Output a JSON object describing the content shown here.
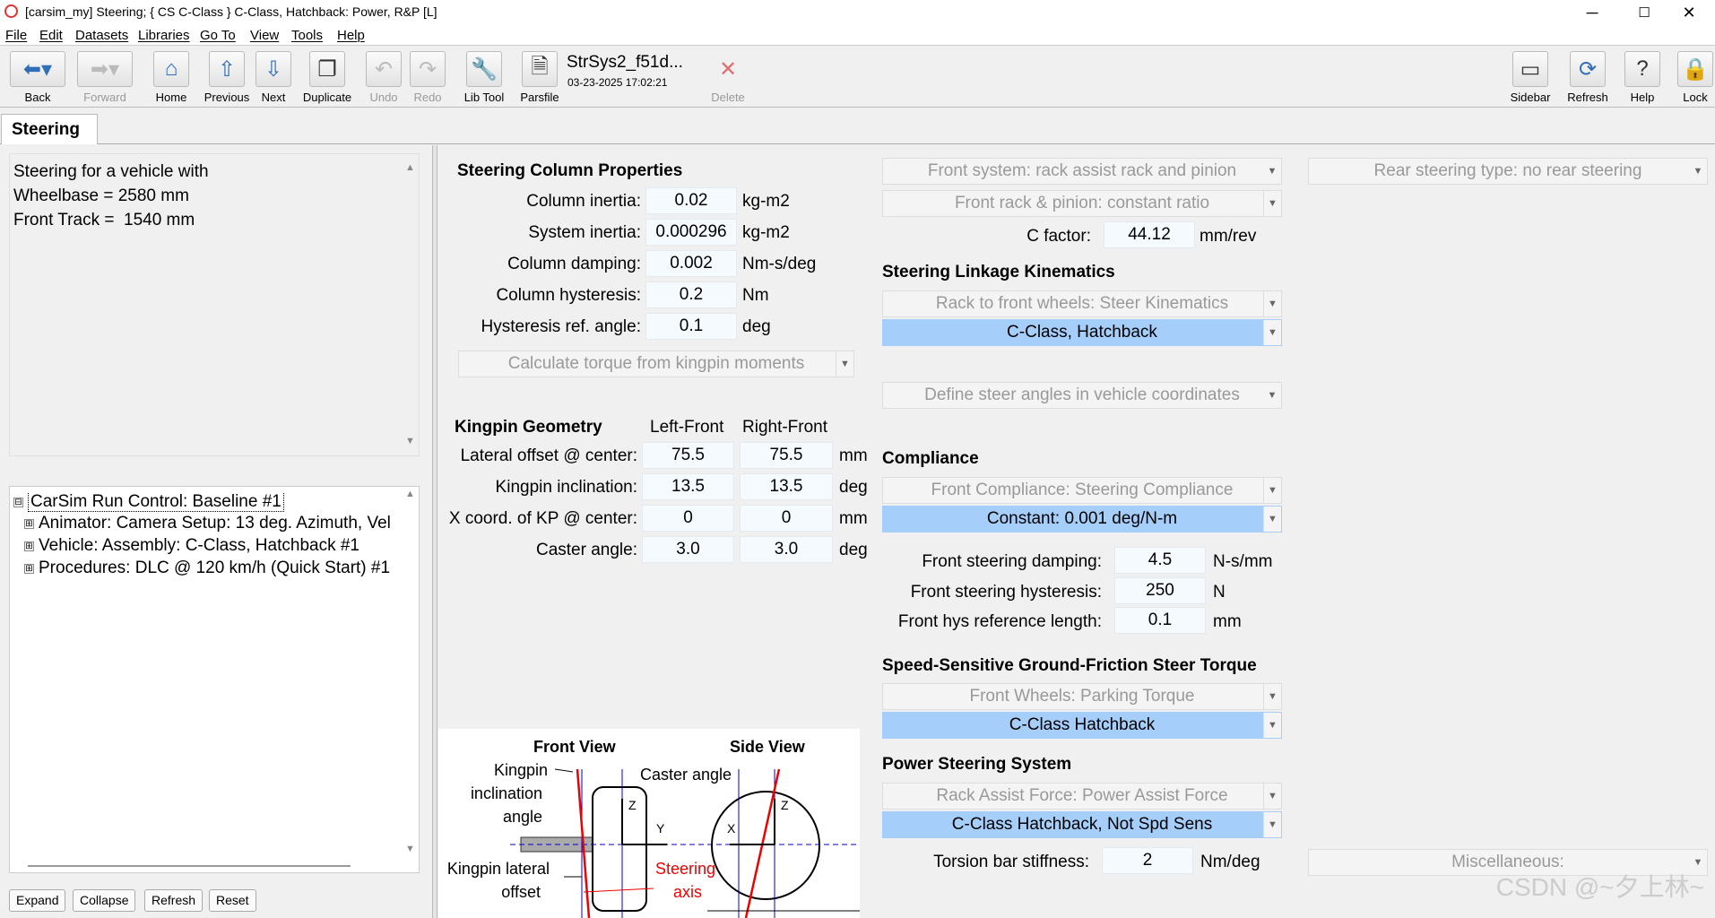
{
  "window": {
    "title": "[carsim_my] Steering; { CS C-Class } C-Class, Hatchback: Power, R&P [L]",
    "minimize": "─",
    "maximize": "☐",
    "close": "✕"
  },
  "menu": [
    "File",
    "Edit",
    "Datasets",
    "Libraries",
    "Go To",
    "View",
    "Tools",
    "Help"
  ],
  "toolbar": {
    "back": "Back",
    "forward": "Forward",
    "home": "Home",
    "previous": "Previous",
    "next": "Next",
    "duplicate": "Duplicate",
    "undo": "Undo",
    "redo": "Redo",
    "libtool": "Lib Tool",
    "parsfile": "Parsfile",
    "delete": "Delete",
    "sidebar": "Sidebar",
    "refresh": "Refresh",
    "help": "Help",
    "lock": "Lock",
    "dataset_name": "StrSys2_f51d...",
    "dataset_date": "03-23-2025 17:02:21"
  },
  "tab": "Steering",
  "notes": "Steering for a vehicle with\nWheelbase = 2580 mm\nFront Track =  1540 mm",
  "tree": {
    "root": "CarSim Run Control: Baseline #1",
    "items": [
      "Animator: Camera Setup: 13 deg. Azimuth, Vel",
      "Vehicle: Assembly: C-Class, Hatchback #1",
      "Procedures: DLC @ 120 km/h (Quick Start) #1"
    ],
    "expand": "⊞",
    "collapse": "⊟"
  },
  "buttons": {
    "expand": "Expand",
    "collapse": "Collapse",
    "refresh": "Refresh",
    "reset": "Reset"
  },
  "column": {
    "title": "Steering Column Properties",
    "rows": [
      {
        "label": "Column inertia:",
        "value": "0.02",
        "unit": "kg-m2"
      },
      {
        "label": "System inertia:",
        "value": "0.000296",
        "unit": "kg-m2"
      },
      {
        "label": "Column damping:",
        "value": "0.002",
        "unit": "Nm-s/deg"
      },
      {
        "label": "Column hysteresis:",
        "value": "0.2",
        "unit": "Nm"
      },
      {
        "label": "Hysteresis ref. angle:",
        "value": "0.1",
        "unit": "deg"
      }
    ],
    "torque_combo": "Calculate torque from kingpin moments"
  },
  "kingpin": {
    "title": "Kingpin Geometry",
    "left": "Left-Front",
    "right": "Right-Front",
    "rows": [
      {
        "label": "Lateral offset @ center:",
        "l": "75.5",
        "r": "75.5",
        "unit": "mm"
      },
      {
        "label": "Kingpin inclination:",
        "l": "13.5",
        "r": "13.5",
        "unit": "deg"
      },
      {
        "label": "X coord. of KP @ center:",
        "l": "0",
        "r": "0",
        "unit": "mm"
      },
      {
        "label": "Caster angle:",
        "l": "3.0",
        "r": "3.0",
        "unit": "deg"
      }
    ]
  },
  "diagram": {
    "front_view": "Front View",
    "side_view": "Side View",
    "kp_incl": "Kingpin",
    "kp_incl2": "inclination",
    "kp_incl3": "angle",
    "kp_lat": "Kingpin lateral",
    "kp_lat2": "offset",
    "caster": "Caster angle",
    "steer": "Steering",
    "steer2": "axis",
    "z": "Z",
    "y": "Y",
    "x": "X"
  },
  "right": {
    "front_system": "Front system: rack assist rack and pinion",
    "rear_type": "Rear steering type: no rear steering",
    "rack_ratio": "Front rack & pinion: constant ratio",
    "cfactor_label": "C factor:",
    "cfactor": "44.12",
    "cfactor_unit": "mm/rev",
    "linkage_title": "Steering Linkage Kinematics",
    "linkage_combo": "Rack to front wheels: Steer Kinematics",
    "linkage_val": "C-Class, Hatchback",
    "steer_angles": "Define steer angles in vehicle coordinates",
    "compliance_title": "Compliance",
    "compliance_combo": "Front Compliance: Steering Compliance",
    "compliance_val": "Constant: 0.001 deg/N-m",
    "damp_label": "Front steering damping:",
    "damp": "4.5",
    "damp_unit": "N-s/mm",
    "hyst_label": "Front steering hysteresis:",
    "hyst": "250",
    "hyst_unit": "N",
    "hysref_label": "Front hys reference length:",
    "hysref": "0.1",
    "hysref_unit": "mm",
    "speed_title": "Speed-Sensitive Ground-Friction Steer Torque",
    "speed_combo": "Front Wheels: Parking Torque",
    "speed_val": "C-Class Hatchback",
    "power_title": "Power Steering System",
    "power_combo": "Rack Assist Force: Power Assist Force",
    "power_val": "C-Class Hatchback, Not Spd Sens",
    "torsion_label": "Torsion bar stiffness:",
    "torsion": "2",
    "torsion_unit": "Nm/deg",
    "misc": "Miscellaneous:"
  },
  "watermark": "CSDN @~夕上林~"
}
